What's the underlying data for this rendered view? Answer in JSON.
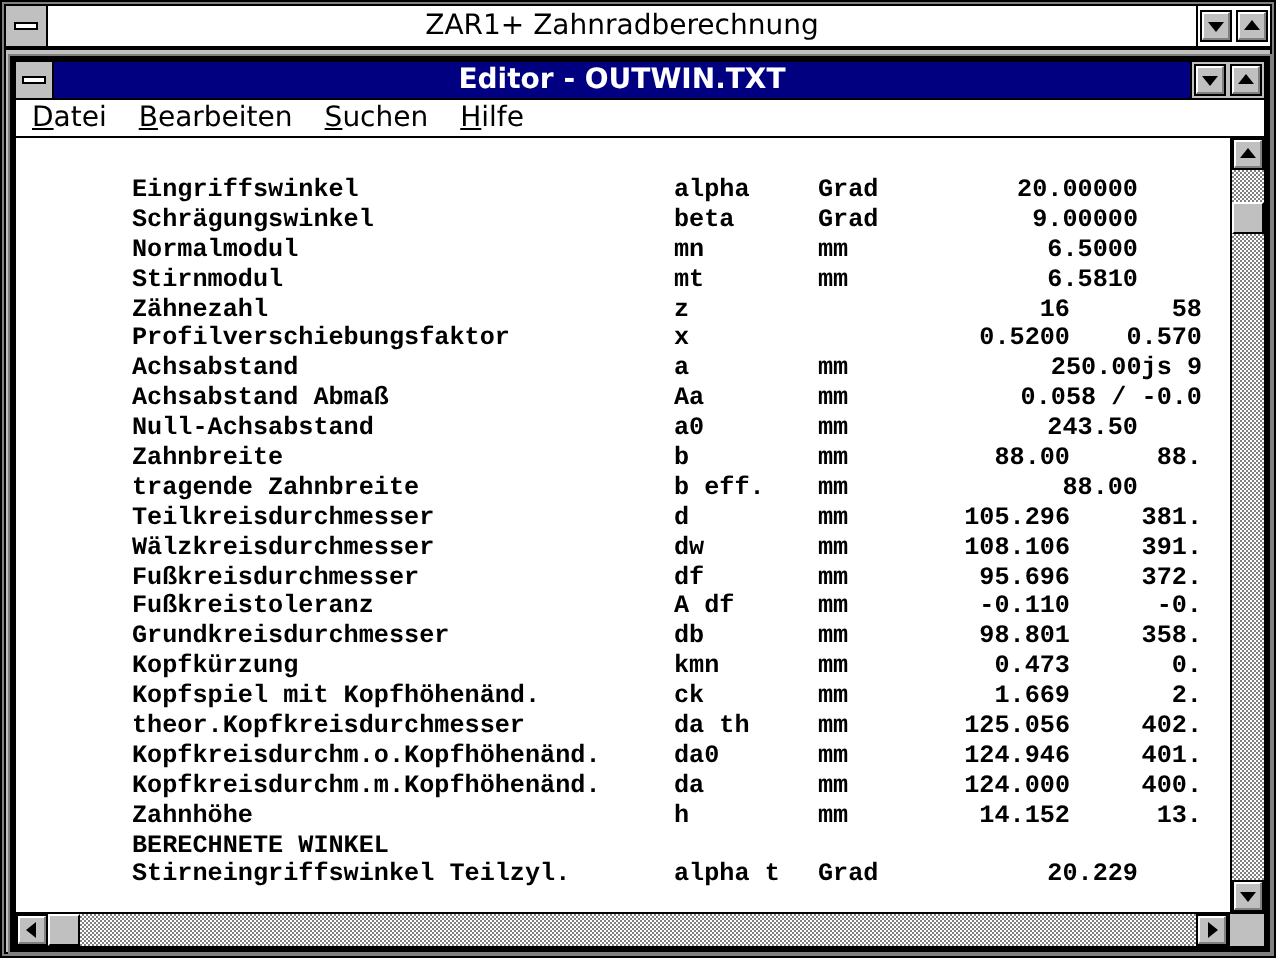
{
  "app_window": {
    "title": "ZAR1+  Zahnradberechnung"
  },
  "editor_window": {
    "title": "Editor - OUTWIN.TXT"
  },
  "menu": [
    "Datei",
    "Bearbeiten",
    "Suchen",
    "Hilfe"
  ],
  "rows": [
    {
      "kind": "single",
      "label": "Eingriffswinkel",
      "symbol": "alpha",
      "unit": "Grad",
      "values": [
        "20.00000"
      ]
    },
    {
      "kind": "single",
      "label": "Schrägungswinkel",
      "symbol": "beta",
      "unit": "Grad",
      "values": [
        "9.00000"
      ]
    },
    {
      "kind": "single",
      "label": "Normalmodul",
      "symbol": "mn",
      "unit": "mm",
      "values": [
        "6.5000"
      ]
    },
    {
      "kind": "single",
      "label": "Stirnmodul",
      "symbol": "mt",
      "unit": "mm",
      "values": [
        "6.5810"
      ]
    },
    {
      "kind": "pair",
      "label": "Zähnezahl",
      "symbol": "z",
      "values": [
        "16",
        "58"
      ]
    },
    {
      "kind": "pair",
      "label": "Profilverschiebungsfaktor",
      "symbol": "x",
      "values": [
        "0.5200",
        "0.570"
      ]
    },
    {
      "kind": "wide",
      "label": "Achsabstand",
      "symbol": "a",
      "unit": "mm",
      "values": [
        "250.00js 9"
      ]
    },
    {
      "kind": "wide",
      "label": "Achsabstand Abmaß",
      "symbol": "Aa",
      "unit": "mm",
      "values": [
        "0.058 / -0.0"
      ]
    },
    {
      "kind": "single",
      "label": "Null-Achsabstand",
      "symbol": "a0",
      "unit": "mm",
      "values": [
        "243.50"
      ]
    },
    {
      "kind": "pair",
      "label": "Zahnbreite",
      "symbol": "b",
      "unit": "mm",
      "values": [
        "88.00",
        "88."
      ]
    },
    {
      "kind": "single",
      "label": "tragende Zahnbreite",
      "symbol": "b eff.",
      "unit": "mm",
      "values": [
        "88.00"
      ]
    },
    {
      "kind": "pair",
      "label": "Teilkreisdurchmesser",
      "symbol": "d",
      "unit": "mm",
      "values": [
        "105.296",
        "381."
      ]
    },
    {
      "kind": "pair",
      "label": "Wälzkreisdurchmesser",
      "symbol": "dw",
      "unit": "mm",
      "values": [
        "108.106",
        "391."
      ]
    },
    {
      "kind": "pair",
      "label": "Fußkreisdurchmesser",
      "symbol": "df",
      "unit": "mm",
      "values": [
        "95.696",
        "372."
      ]
    },
    {
      "kind": "pair",
      "label": "Fußkreistoleranz",
      "symbol": "A df",
      "unit": "mm",
      "values": [
        "-0.110",
        "-0."
      ]
    },
    {
      "kind": "pair",
      "label": "Grundkreisdurchmesser",
      "symbol": "db",
      "unit": "mm",
      "values": [
        "98.801",
        "358."
      ]
    },
    {
      "kind": "pair",
      "label": "Kopfkürzung",
      "symbol": "kmn",
      "unit": "mm",
      "values": [
        "0.473",
        "0."
      ]
    },
    {
      "kind": "pair",
      "label": "Kopfspiel mit Kopfhöhenänd.",
      "symbol": "ck",
      "unit": "mm",
      "values": [
        "1.669",
        "2."
      ]
    },
    {
      "kind": "pair",
      "label": "theor.Kopfkreisdurchmesser",
      "symbol": "da th",
      "unit": "mm",
      "values": [
        "125.056",
        "402."
      ]
    },
    {
      "kind": "pair",
      "label": "Kopfkreisdurchm.o.Kopfhöhenänd.",
      "symbol": "da0",
      "unit": "mm",
      "values": [
        "124.946",
        "401."
      ]
    },
    {
      "kind": "pair",
      "label": "Kopfkreisdurchm.m.Kopfhöhenänd.",
      "symbol": "da",
      "unit": "mm",
      "values": [
        "124.000",
        "400."
      ]
    },
    {
      "kind": "pair",
      "label": "Zahnhöhe",
      "symbol": "h",
      "unit": "mm",
      "values": [
        "14.152",
        "13."
      ]
    },
    {
      "kind": "heading",
      "label": "BERECHNETE WINKEL"
    },
    {
      "kind": "single",
      "label": "Stirneingriffswinkel Teilzyl.",
      "symbol": "alpha t",
      "unit": "Grad",
      "values": [
        "20.229"
      ]
    }
  ]
}
